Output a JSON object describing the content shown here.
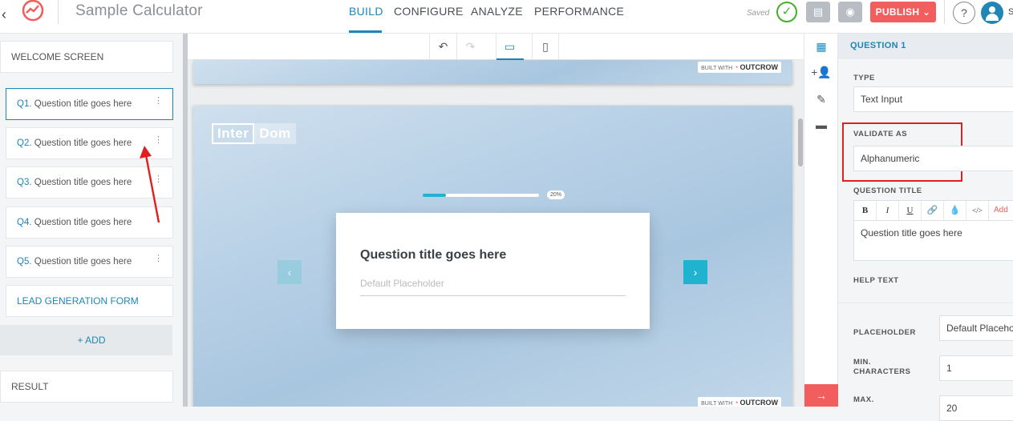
{
  "header": {
    "back_glyph": "‹",
    "app_title": "Sample Calculator",
    "nav": [
      "BUILD",
      "CONFIGURE",
      "ANALYZE",
      "PERFORMANCE"
    ],
    "active_nav": "BUILD",
    "saved_label": "Saved",
    "publish_label": "PUBLISH ⌄",
    "help_label": "?",
    "user_initial": "S"
  },
  "sidebar": {
    "welcome": "WELCOME SCREEN",
    "questions": [
      {
        "num": "Q1.",
        "title": "Question title goes here"
      },
      {
        "num": "Q2.",
        "title": "Question title goes here"
      },
      {
        "num": "Q3.",
        "title": "Question title goes here"
      },
      {
        "num": "Q4.",
        "title": "Question title goes here"
      },
      {
        "num": "Q5.",
        "title": "Question title goes here"
      }
    ],
    "lead_form": "LEAD GENERATION FORM",
    "add_label": "+ ADD",
    "result": "RESULT"
  },
  "canvas": {
    "badge_prefix": "BUILT WITH",
    "badge_brand": "OUTCROW",
    "brand_part1": "Inter",
    "brand_part2": "Dom",
    "progress_label": "20%",
    "progress_value": 0.2,
    "question_title": "Question title goes here",
    "input_placeholder": "Default Placeholder",
    "prev_glyph": "‹",
    "next_glyph": "›"
  },
  "right_panel": {
    "header": "QUESTION 1",
    "type_label": "TYPE",
    "type_value": "Text Input",
    "validate_label": "VALIDATE AS",
    "validate_value": "Alphanumeric",
    "question_title_label": "QUESTION TITLE",
    "rte_buttons": [
      "B",
      "I",
      "U",
      "🔗",
      "💧",
      "</>"
    ],
    "rte_add": "Add",
    "question_title_value": "Question title goes here",
    "help_text_label": "HELP TEXT",
    "placeholder_label": "PLACEHOLDER",
    "placeholder_value": "Default Placeholder",
    "min_chars_label": "MIN. CHARACTERS",
    "min_chars_value": "1",
    "max_chars_label": "MAX.",
    "max_chars_value": "20"
  },
  "colors": {
    "accent": "#1f86b5",
    "publish": "#f25d5d",
    "saved": "#43b02a",
    "highlight": "#e02020",
    "cyan": "#1fb3d0"
  },
  "icons": [
    "back-icon",
    "logo-icon",
    "check-icon",
    "pages-icon",
    "eye-icon",
    "help-icon",
    "user-icon",
    "undo-icon",
    "redo-icon",
    "desktop-icon",
    "mobile-icon",
    "layout-icon",
    "add-user-icon",
    "pen-icon",
    "card-icon",
    "arrow-right-icon"
  ]
}
